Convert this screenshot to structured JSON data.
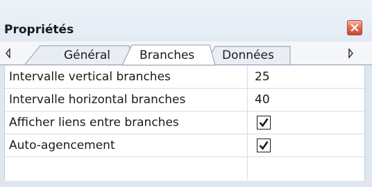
{
  "panel": {
    "title": "Propriétés"
  },
  "tabs": [
    {
      "label": "Général",
      "active": false
    },
    {
      "label": "Branches",
      "active": true
    },
    {
      "label": "Données",
      "active": false
    }
  ],
  "properties": [
    {
      "name": "Intervalle vertical branches",
      "type": "number",
      "value": "25"
    },
    {
      "name": "Intervalle horizontal branches",
      "type": "number",
      "value": "40"
    },
    {
      "name": "Afficher liens entre branches",
      "type": "checkbox",
      "checked": true
    },
    {
      "name": "Auto-agencement",
      "type": "checkbox",
      "checked": true
    }
  ],
  "icons": {
    "close": "close-icon",
    "scroll_left": "chevron-left-icon",
    "scroll_right": "chevron-right-icon",
    "check": "check-icon"
  },
  "colors": {
    "panel_bg": "#dfe6ef",
    "close_button": "#d9553c"
  }
}
